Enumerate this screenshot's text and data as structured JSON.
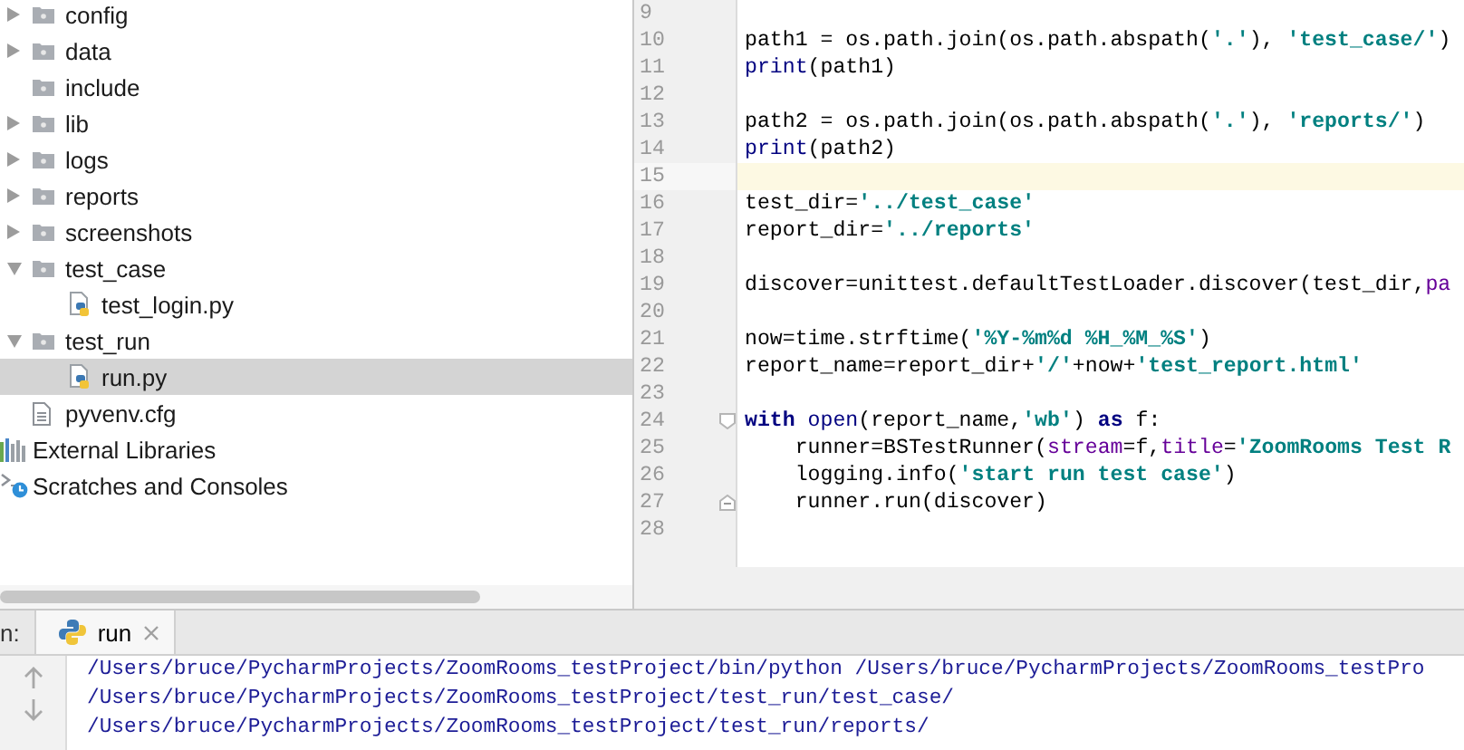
{
  "project_tree": {
    "project_items": [
      {
        "label": "config",
        "kind": "folder",
        "expanded": false,
        "selected": false
      },
      {
        "label": "data",
        "kind": "folder",
        "expanded": false,
        "selected": false
      },
      {
        "label": "include",
        "kind": "folder",
        "selected": false
      },
      {
        "label": "lib",
        "kind": "folder",
        "expanded": false,
        "selected": false
      },
      {
        "label": "logs",
        "kind": "folder",
        "expanded": false,
        "selected": false
      },
      {
        "label": "reports",
        "kind": "folder",
        "expanded": false,
        "selected": false
      },
      {
        "label": "screenshots",
        "kind": "folder",
        "expanded": false,
        "selected": false
      },
      {
        "label": "test_case",
        "kind": "folder",
        "expanded": true,
        "selected": false,
        "children": [
          {
            "label": "test_login.py",
            "kind": "python-file",
            "selected": false
          }
        ]
      },
      {
        "label": "test_run",
        "kind": "folder",
        "expanded": true,
        "selected": false,
        "children": [
          {
            "label": "run.py",
            "kind": "python-file",
            "selected": true
          }
        ]
      },
      {
        "label": "pyvenv.cfg",
        "kind": "text-file",
        "selected": false
      }
    ],
    "other_items": [
      {
        "label": "External Libraries",
        "kind": "libraries",
        "selected": false
      },
      {
        "label": "Scratches and Consoles",
        "kind": "scratches",
        "selected": false
      }
    ]
  },
  "editor": {
    "lines": [
      {
        "number": "9",
        "current": false
      },
      {
        "number": "10",
        "current": false,
        "tokens": [
          {
            "kind": "plain",
            "text": "path1 = os.path.join(os.path.abspath("
          },
          {
            "kind": "string",
            "text": "'.'"
          },
          {
            "kind": "plain",
            "text": "), "
          },
          {
            "kind": "string",
            "text": "'test_case/'"
          },
          {
            "kind": "plain",
            "text": ")"
          }
        ]
      },
      {
        "number": "11",
        "current": false,
        "tokens": [
          {
            "kind": "builtin",
            "text": "print"
          },
          {
            "kind": "plain",
            "text": "(path1)"
          }
        ]
      },
      {
        "number": "12",
        "current": false
      },
      {
        "number": "13",
        "current": false,
        "tokens": [
          {
            "kind": "plain",
            "text": "path2 = os.path.join(os.path.abspath("
          },
          {
            "kind": "string",
            "text": "'.'"
          },
          {
            "kind": "plain",
            "text": "), "
          },
          {
            "kind": "string",
            "text": "'reports/'"
          },
          {
            "kind": "plain",
            "text": ")"
          }
        ]
      },
      {
        "number": "14",
        "current": false,
        "tokens": [
          {
            "kind": "builtin",
            "text": "print"
          },
          {
            "kind": "plain",
            "text": "(path2)"
          }
        ]
      },
      {
        "number": "15",
        "current": true
      },
      {
        "number": "16",
        "current": false,
        "tokens": [
          {
            "kind": "plain",
            "text": "test_dir="
          },
          {
            "kind": "string",
            "text": "'../test_case'"
          }
        ]
      },
      {
        "number": "17",
        "current": false,
        "tokens": [
          {
            "kind": "plain",
            "text": "report_dir="
          },
          {
            "kind": "string",
            "text": "'../reports'"
          }
        ]
      },
      {
        "number": "18",
        "current": false
      },
      {
        "number": "19",
        "current": false,
        "tokens": [
          {
            "kind": "plain",
            "text": "discover=unittest.defaultTestLoader.discover(test_dir,"
          },
          {
            "kind": "param",
            "text": "pa"
          }
        ]
      },
      {
        "number": "20",
        "current": false
      },
      {
        "number": "21",
        "current": false,
        "tokens": [
          {
            "kind": "plain",
            "text": "now=time.strftime("
          },
          {
            "kind": "string",
            "text": "'%Y-%m%d %H_%M_%S'"
          },
          {
            "kind": "plain",
            "text": ")"
          }
        ]
      },
      {
        "number": "22",
        "current": false,
        "tokens": [
          {
            "kind": "plain",
            "text": "report_name=report_dir+"
          },
          {
            "kind": "string",
            "text": "'/'"
          },
          {
            "kind": "plain",
            "text": "+now+"
          },
          {
            "kind": "string",
            "text": "'test_report.html'"
          }
        ]
      },
      {
        "number": "23",
        "current": false
      },
      {
        "number": "24",
        "current": false,
        "kind": "fold-start",
        "tokens": [
          {
            "kind": "keyword",
            "text": "with "
          },
          {
            "kind": "builtin",
            "text": "open"
          },
          {
            "kind": "plain",
            "text": "(report_name,"
          },
          {
            "kind": "string",
            "text": "'wb'"
          },
          {
            "kind": "plain",
            "text": ") "
          },
          {
            "kind": "keyword",
            "text": "as"
          },
          {
            "kind": "plain",
            "text": " f:"
          }
        ]
      },
      {
        "number": "25",
        "current": false,
        "tokens": [
          {
            "kind": "plain",
            "text": "    runner=BSTestRunner("
          },
          {
            "kind": "param",
            "text": "stream"
          },
          {
            "kind": "plain",
            "text": "=f,"
          },
          {
            "kind": "param",
            "text": "title"
          },
          {
            "kind": "plain",
            "text": "="
          },
          {
            "kind": "string",
            "text": "'ZoomRooms Test R"
          }
        ]
      },
      {
        "number": "26",
        "current": false,
        "tokens": [
          {
            "kind": "plain",
            "text": "    logging.info("
          },
          {
            "kind": "string",
            "text": "'start run test case'"
          },
          {
            "kind": "plain",
            "text": ")"
          }
        ]
      },
      {
        "number": "27",
        "current": false,
        "kind": "fold-end",
        "tokens": [
          {
            "kind": "plain",
            "text": "    runner.run(discover)"
          }
        ]
      },
      {
        "number": "28",
        "current": false
      }
    ]
  },
  "run_panel": {
    "label": "n:",
    "tabs": [
      {
        "label": "run",
        "selected": true
      }
    ],
    "output": [
      "/Users/bruce/PycharmProjects/ZoomRooms_testProject/bin/python /Users/bruce/PycharmProjects/ZoomRooms_testPro",
      "/Users/bruce/PycharmProjects/ZoomRooms_testProject/test_run/test_case/",
      "/Users/bruce/PycharmProjects/ZoomRooms_testProject/test_run/reports/"
    ]
  }
}
